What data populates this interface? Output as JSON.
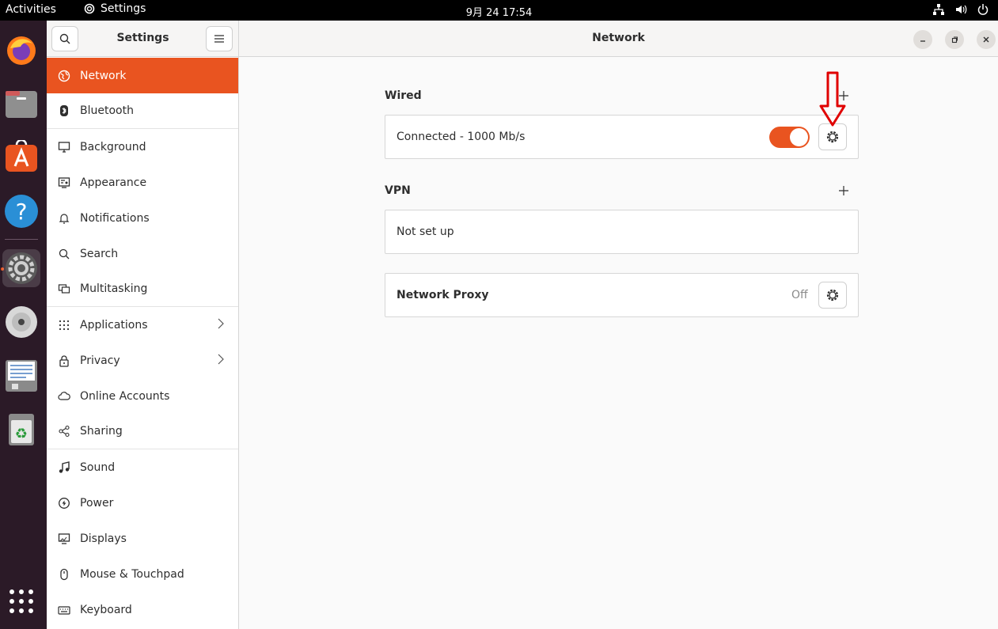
{
  "topbar": {
    "activities": "Activities",
    "app_name": "Settings",
    "clock": "9月 24  17:54"
  },
  "sidebar": {
    "title": "Settings",
    "items": [
      {
        "label": "Network",
        "icon": "globe-icon"
      },
      {
        "label": "Bluetooth",
        "icon": "bluetooth-icon"
      },
      {
        "label": "Background",
        "icon": "monitor-icon"
      },
      {
        "label": "Appearance",
        "icon": "appearance-icon"
      },
      {
        "label": "Notifications",
        "icon": "bell-icon"
      },
      {
        "label": "Search",
        "icon": "search-icon"
      },
      {
        "label": "Multitasking",
        "icon": "multitasking-icon"
      },
      {
        "label": "Applications",
        "icon": "grid-icon"
      },
      {
        "label": "Privacy",
        "icon": "lock-icon"
      },
      {
        "label": "Online Accounts",
        "icon": "cloud-icon"
      },
      {
        "label": "Sharing",
        "icon": "share-icon"
      },
      {
        "label": "Sound",
        "icon": "music-icon"
      },
      {
        "label": "Power",
        "icon": "power-icon"
      },
      {
        "label": "Displays",
        "icon": "display-icon"
      },
      {
        "label": "Mouse & Touchpad",
        "icon": "mouse-icon"
      },
      {
        "label": "Keyboard",
        "icon": "keyboard-icon"
      }
    ]
  },
  "main": {
    "title": "Network",
    "wired": {
      "label": "Wired",
      "status": "Connected - 1000 Mb/s",
      "enabled": true
    },
    "vpn": {
      "label": "VPN",
      "status": "Not set up"
    },
    "proxy": {
      "label": "Network Proxy",
      "status": "Off"
    }
  },
  "colors": {
    "accent": "#e95420",
    "dock": "#2b1a27",
    "annotation_arrow": "#e00000"
  }
}
